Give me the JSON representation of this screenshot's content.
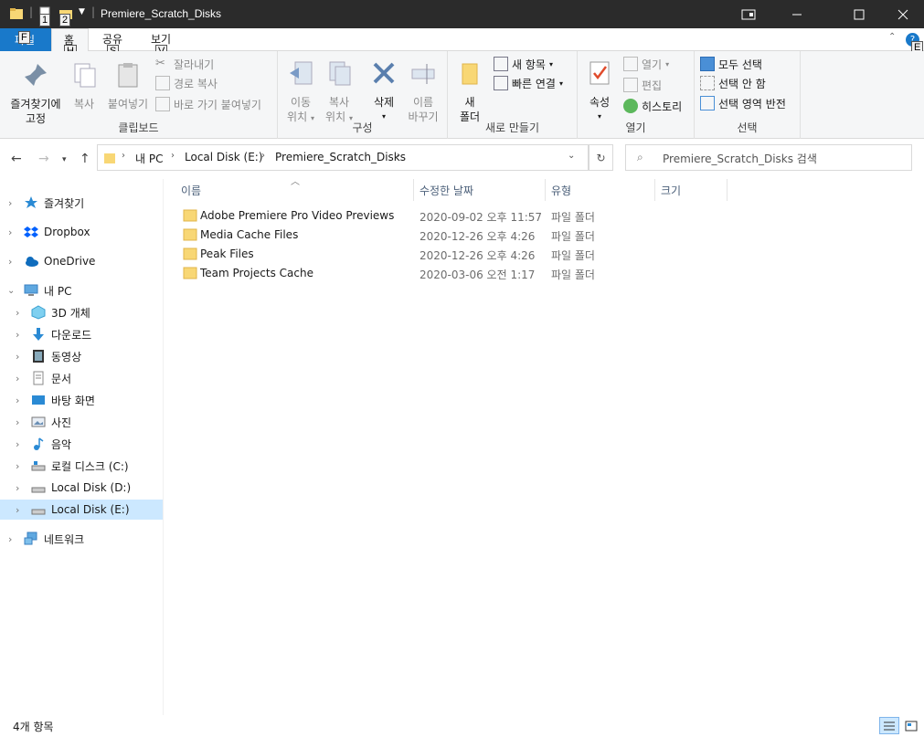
{
  "window": {
    "title": "Premiere_Scratch_Disks"
  },
  "quick_access": {
    "keytip1": "1",
    "keytip2": "2"
  },
  "ribbon_tabs": [
    {
      "label": "파일",
      "keytip": "F"
    },
    {
      "label": "홈",
      "keytip": "H"
    },
    {
      "label": "공유",
      "keytip": "S"
    },
    {
      "label": "보기",
      "keytip": "V"
    }
  ],
  "help_keytip": "E",
  "ribbon": {
    "clipboard": {
      "label": "클립보드",
      "pin": [
        "즐겨찾기에",
        "고정"
      ],
      "copy": "복사",
      "paste": "붙여넣기",
      "cut": "잘라내기",
      "copy_path": "경로 복사",
      "paste_shortcut": "바로 가기 붙여넣기"
    },
    "organize": {
      "label": "구성",
      "move_to": [
        "이동",
        "위치"
      ],
      "copy_to": [
        "복사",
        "위치"
      ],
      "delete": "삭제",
      "rename": [
        "이름",
        "바꾸기"
      ]
    },
    "new": {
      "label": "새로 만들기",
      "new_folder": [
        "새",
        "폴더"
      ],
      "new_item": "새 항목",
      "easy_access": "빠른 연결"
    },
    "open": {
      "label": "열기",
      "properties": "속성",
      "open": "열기",
      "edit": "편집",
      "history": "히스토리"
    },
    "select": {
      "label": "선택",
      "select_all": "모두 선택",
      "select_none": "선택 안 함",
      "invert": "선택 영역 반전"
    }
  },
  "address": {
    "crumbs": [
      "내 PC",
      "Local Disk (E:)",
      "Premiere_Scratch_Disks"
    ]
  },
  "search": {
    "placeholder": "Premiere_Scratch_Disks 검색"
  },
  "tree": [
    {
      "label": "즐겨찾기",
      "icon": "star-icon"
    },
    {
      "label": "Dropbox",
      "icon": "dropbox-icon"
    },
    {
      "label": "OneDrive",
      "icon": "cloud-icon"
    },
    {
      "label": "내 PC",
      "icon": "pc-icon"
    },
    {
      "label": "3D 개체",
      "icon": "cube-icon"
    },
    {
      "label": "다운로드",
      "icon": "download-icon"
    },
    {
      "label": "동영상",
      "icon": "video-icon"
    },
    {
      "label": "문서",
      "icon": "document-icon"
    },
    {
      "label": "바탕 화면",
      "icon": "desktop-icon"
    },
    {
      "label": "사진",
      "icon": "picture-icon"
    },
    {
      "label": "음악",
      "icon": "music-icon"
    },
    {
      "label": "로컬 디스크 (C:)",
      "icon": "drive-icon"
    },
    {
      "label": "Local Disk (D:)",
      "icon": "drive-icon"
    },
    {
      "label": "Local Disk (E:)",
      "icon": "drive-icon"
    },
    {
      "label": "네트워크",
      "icon": "network-icon"
    }
  ],
  "columns": {
    "name": "이름",
    "date": "수정한 날짜",
    "type": "유형",
    "size": "크기"
  },
  "files": [
    {
      "name": "Adobe Premiere Pro Video Previews",
      "date": "2020-09-02 오후 11:57",
      "type": "파일 폴더"
    },
    {
      "name": "Media Cache Files",
      "date": "2020-12-26 오후 4:26",
      "type": "파일 폴더"
    },
    {
      "name": "Peak Files",
      "date": "2020-12-26 오후 4:26",
      "type": "파일 폴더"
    },
    {
      "name": "Team Projects Cache",
      "date": "2020-03-06 오전 1:17",
      "type": "파일 폴더"
    }
  ],
  "status": {
    "count": "4개 항목"
  },
  "colors": {
    "accent": "#0078d7",
    "selection": "#cce8ff",
    "folder": "#f8d775",
    "titlebar": "#2b2b2b"
  }
}
